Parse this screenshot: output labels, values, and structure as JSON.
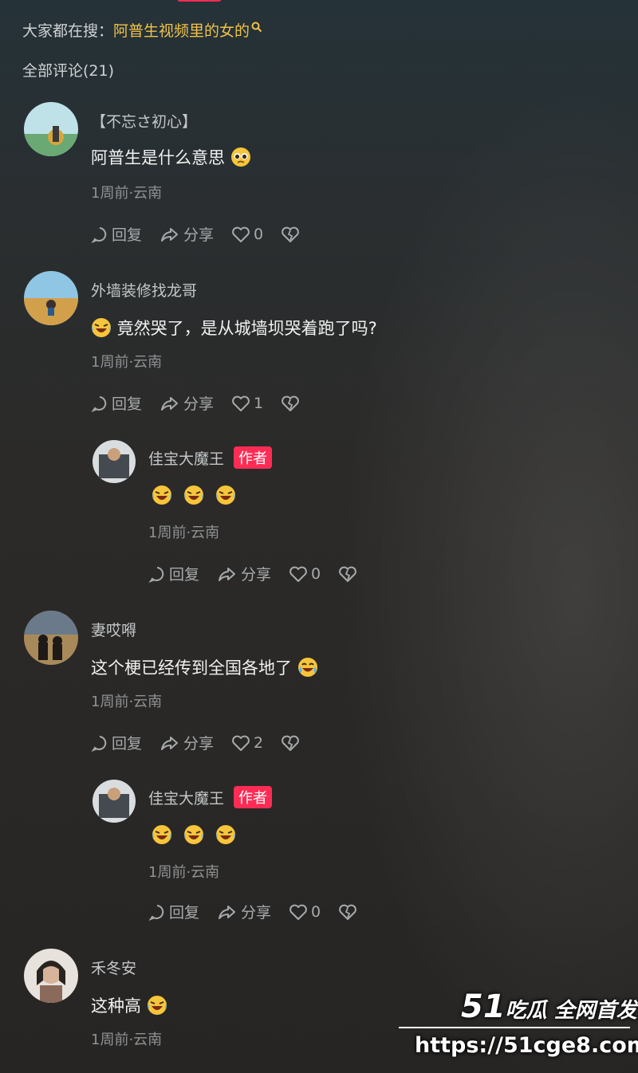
{
  "search": {
    "prefix": "大家都在搜：",
    "keyword": "阿普生视频里的女的",
    "icon": "search-icon"
  },
  "comments_total": "全部评论(21)",
  "actions": {
    "reply": "回复",
    "share": "分享"
  },
  "comments": [
    {
      "user": "【不忘さ初心】",
      "text": "阿普生是什么意思",
      "emoji": "pleading-face",
      "meta": "1周前·云南",
      "likes": "0"
    },
    {
      "user": "外墙装修找龙哥",
      "text": "竟然哭了，是从城墙坝哭着跑了吗?",
      "emoji": "rolling-laughing-face",
      "meta": "1周前·云南",
      "likes": "1"
    },
    {
      "user": "妻哎嘚",
      "text": "这个梗已经传到全国各地了",
      "emoji": "tears-of-joy-face",
      "meta": "1周前·云南",
      "likes": "2"
    },
    {
      "user": "禾冬安",
      "text": "这种高",
      "emoji": "rolling-laughing-face",
      "meta": "1周前·云南"
    }
  ],
  "replies": [
    {
      "user": "佳宝大魔王",
      "badge": "作者",
      "emojis": [
        "rolling-laughing-face",
        "rolling-laughing-face",
        "rolling-laughing-face"
      ],
      "meta": "1周前·云南",
      "likes": "0"
    },
    {
      "user": "佳宝大魔王",
      "badge": "作者",
      "emojis": [
        "rolling-laughing-face",
        "rolling-laughing-face",
        "rolling-laughing-face"
      ],
      "meta": "1周前·云南",
      "likes": "0"
    }
  ],
  "watermark": {
    "brand_num": "51",
    "brand_text": "吃瓜 全网首发",
    "url": "https://51cge8.com"
  },
  "colors": {
    "accent": "#fe2c55",
    "keyword": "#f0c24a"
  }
}
